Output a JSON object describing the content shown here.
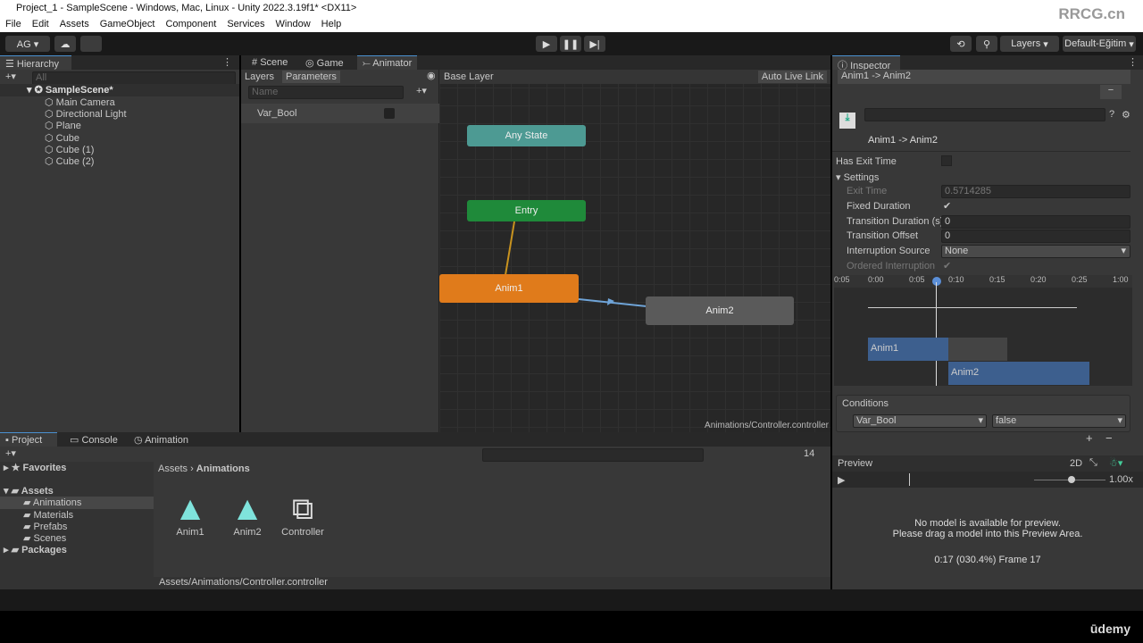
{
  "window_title": "Project_1 - SampleScene - Windows, Mac, Linux - Unity 2022.3.19f1* <DX11>",
  "menu": [
    "File",
    "Edit",
    "Assets",
    "GameObject",
    "Component",
    "Services",
    "Window",
    "Help"
  ],
  "toolbar": {
    "account": "AG ▾",
    "layers": "Layers",
    "layout": "Default-Eğitim"
  },
  "hierarchy": {
    "title": "Hierarchy",
    "search_placeholder": "All",
    "scene": "SampleScene*",
    "items": [
      "Main Camera",
      "Directional Light",
      "Plane",
      "Cube",
      "Cube (1)",
      "Cube (2)"
    ]
  },
  "center_tabs": [
    "Scene",
    "Game",
    "Animator"
  ],
  "animator": {
    "subtabs": [
      "Layers",
      "Parameters"
    ],
    "search_placeholder": "Name",
    "parameter": "Var_Bool",
    "breadcrumb": "Base Layer",
    "auto_live_link": "Auto Live Link",
    "nodes": {
      "any_state": "Any State",
      "entry": "Entry",
      "anim1": "Anim1",
      "anim2": "Anim2"
    },
    "footer_path": "Animations/Controller.controller",
    "node_colors": {
      "any": "#4d9a93",
      "entry": "#1f8a3a",
      "anim1": "#e07b1b",
      "anim2": "#5a5a5a"
    }
  },
  "inspector": {
    "title": "Inspector",
    "transition_list_item": "Anim1 -> Anim2",
    "transition_name": "Anim1 -> Anim2",
    "has_exit_time": "Has Exit Time",
    "settings": "Settings",
    "fields": [
      {
        "label": "Exit Time",
        "value": "0.5714285",
        "disabled": true
      },
      {
        "label": "Fixed Duration",
        "value": "✔"
      },
      {
        "label": "Transition Duration (s)",
        "value": "0"
      },
      {
        "label": "Transition Offset",
        "value": "0"
      },
      {
        "label": "Interruption Source",
        "value": "None"
      },
      {
        "label": "Ordered Interruption",
        "value": "✔",
        "disabled": true
      }
    ],
    "timeline_ticks": [
      "0:05",
      "0:00",
      "0:05",
      "0:10",
      "0:15",
      "0:20",
      "0:25",
      "1:00"
    ],
    "clips": [
      "Anim1",
      "Anim2"
    ],
    "conditions": {
      "title": "Conditions",
      "param": "Var_Bool",
      "value": "false"
    },
    "preview": {
      "title": "Preview",
      "mode": "2D",
      "speed": "1.00x",
      "msg1": "No model is available for preview.",
      "msg2": "Please drag a model into this Preview Area.",
      "time": "0:17 (030.4%) Frame 17"
    }
  },
  "project": {
    "tabs": [
      "Project",
      "Console",
      "Animation"
    ],
    "favorites": "Favorites",
    "assets": "Assets",
    "folders": [
      "Animations",
      "Materials",
      "Prefabs",
      "Scenes"
    ],
    "packages": "Packages",
    "breadcrumb": [
      "Assets",
      "Animations"
    ],
    "files": [
      "Anim1",
      "Anim2",
      "Controller"
    ],
    "footer_path": "Assets/Animations/Controller.controller",
    "count": "14"
  },
  "watermark": "RRCG.cn",
  "udemy": "ūdemy"
}
